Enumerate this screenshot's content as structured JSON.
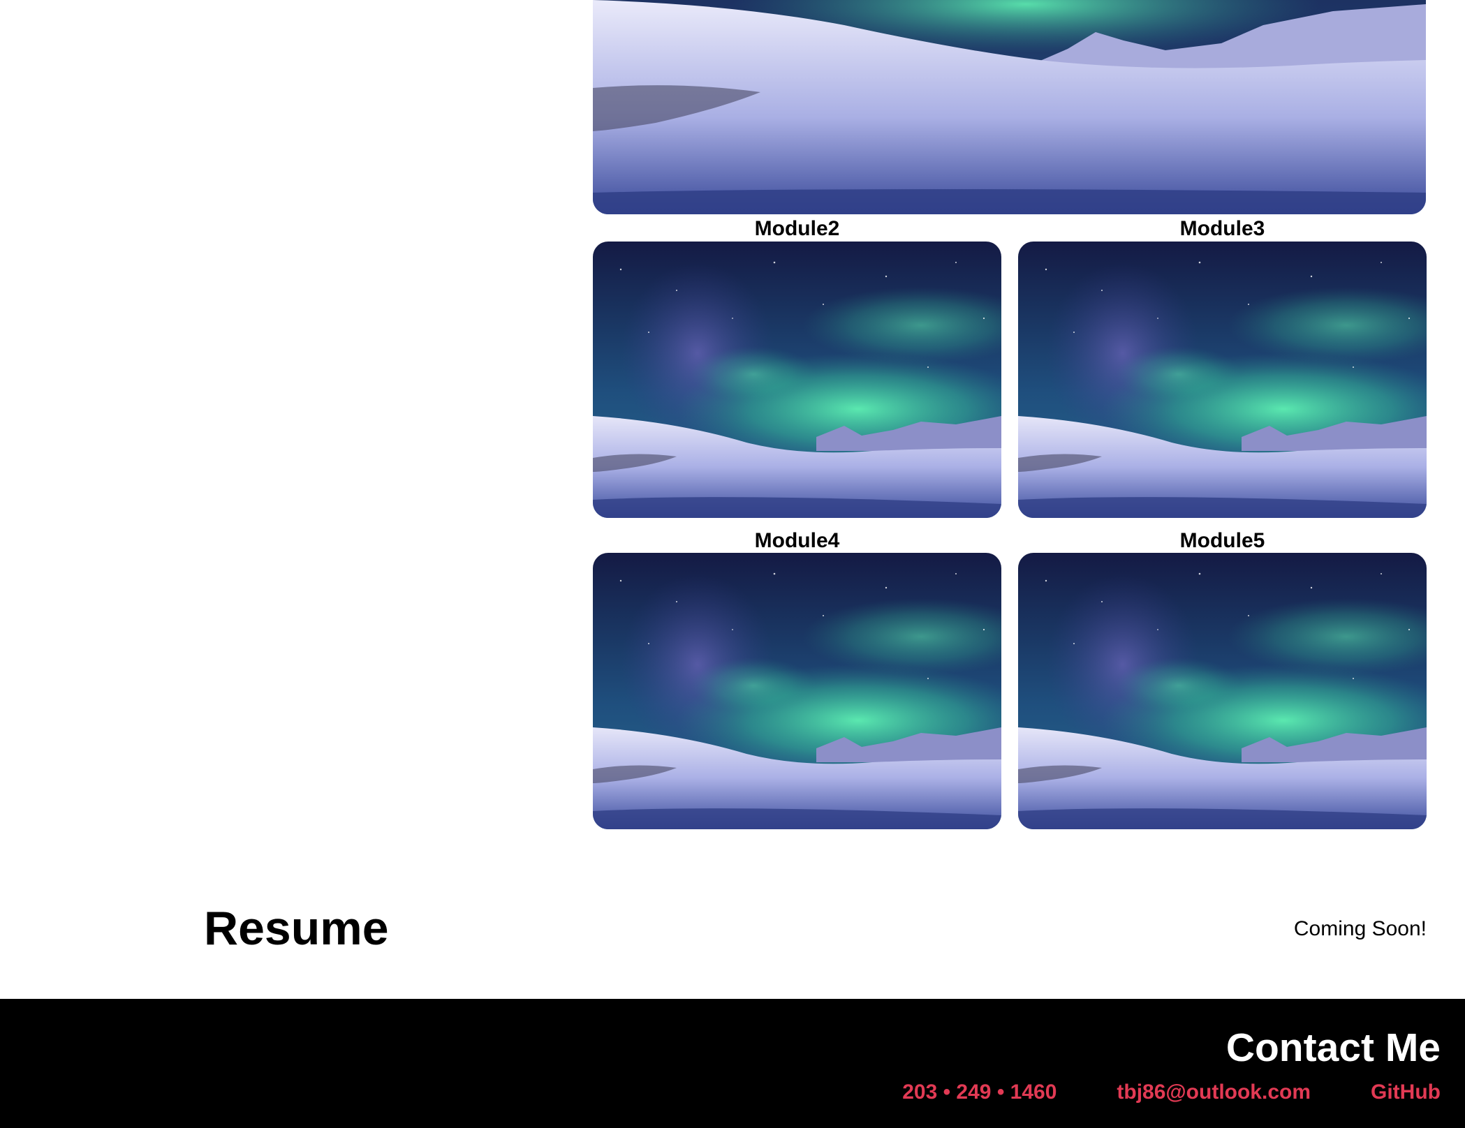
{
  "portfolio": {
    "hero_image": "aurora-over-snow-image",
    "modules": [
      {
        "title": "Module2",
        "image": "aurora-over-snow-image"
      },
      {
        "title": "Module3",
        "image": "aurora-over-snow-image"
      },
      {
        "title": "Module4",
        "image": "aurora-over-snow-image"
      },
      {
        "title": "Module5",
        "image": "aurora-over-snow-image"
      }
    ]
  },
  "resume": {
    "heading": "Resume",
    "status": "Coming Soon!"
  },
  "footer": {
    "heading": "Contact Me",
    "phone": "203 • 249 • 1460",
    "email": "tbj86@outlook.com",
    "github": "GitHub"
  },
  "colors": {
    "link": "#e23a54",
    "footer_bg": "#000000",
    "aurora_green": "#4fe3a8",
    "sky_dark": "#16204a"
  }
}
